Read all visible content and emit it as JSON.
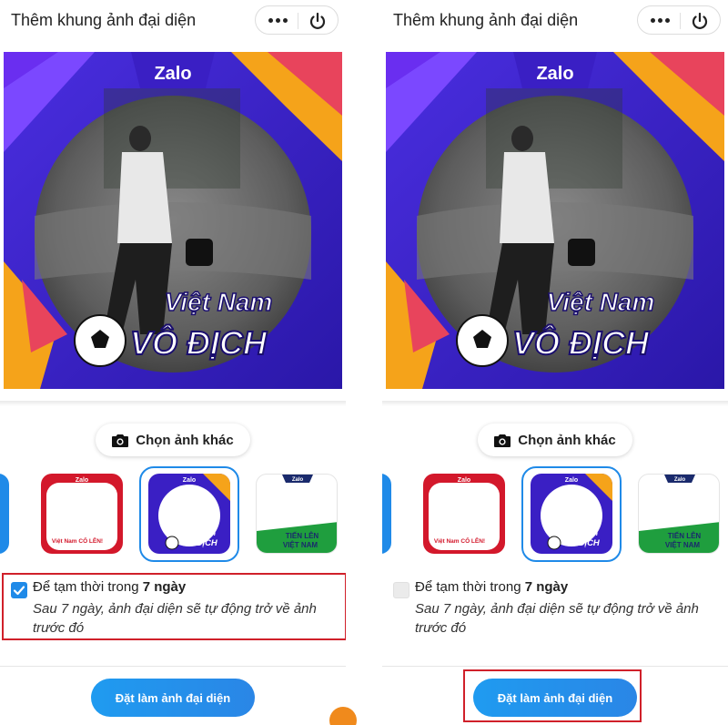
{
  "colors": {
    "accent": "#1f8ae8",
    "highlight_box": "#d0202a",
    "frame_blue": "#3a1fc4",
    "frame_red": "#d3182b",
    "frame_green": "#1f9e3e"
  },
  "panels": [
    {
      "title": "Thêm khung ảnh đại diện",
      "more_icon": "more-dots-icon",
      "power_icon": "power-icon",
      "preview": {
        "brand": "Zalo",
        "line1": "Việt Nam",
        "line2": "VÔ ĐỊCH"
      },
      "choose_label": "Chọn ảnh khác",
      "frames": [
        {
          "brand": "Zalo",
          "caption": "Việt Nam CỐ LÊN!"
        },
        {
          "brand": "Zalo",
          "caption1": "Việt Nam",
          "caption2": "VÔ ĐỊCH"
        },
        {
          "brand": "Zalo",
          "caption1": "TIẾN LÊN",
          "caption2": "VIỆT NAM"
        }
      ],
      "option": {
        "prefix": "Để tạm thời trong ",
        "duration": "7 ngày",
        "note": "Sau 7 ngày, ảnh đại diện sẽ tự động trở về ảnh trước đó",
        "checked": true
      },
      "set_label": "Đặt làm ảnh đại diện"
    },
    {
      "title": "Thêm khung ảnh đại diện",
      "more_icon": "more-dots-icon",
      "power_icon": "power-icon",
      "preview": {
        "brand": "Zalo",
        "line1": "Việt Nam",
        "line2": "VÔ ĐỊCH"
      },
      "choose_label": "Chọn ảnh khác",
      "frames": [
        {
          "brand": "Zalo",
          "caption": "Việt Nam CỐ LÊN!"
        },
        {
          "brand": "Zalo",
          "caption1": "Việt Nam",
          "caption2": "VÔ ĐỊCH"
        },
        {
          "brand": "Zalo",
          "caption1": "TIẾN LÊN",
          "caption2": "VIỆT NAM"
        }
      ],
      "option": {
        "prefix": "Để tạm thời trong ",
        "duration": "7 ngày",
        "note": "Sau 7 ngày, ảnh đại diện sẽ tự động trở về ảnh trước đó",
        "checked": false
      },
      "set_label": "Đặt làm ảnh đại diện"
    }
  ]
}
